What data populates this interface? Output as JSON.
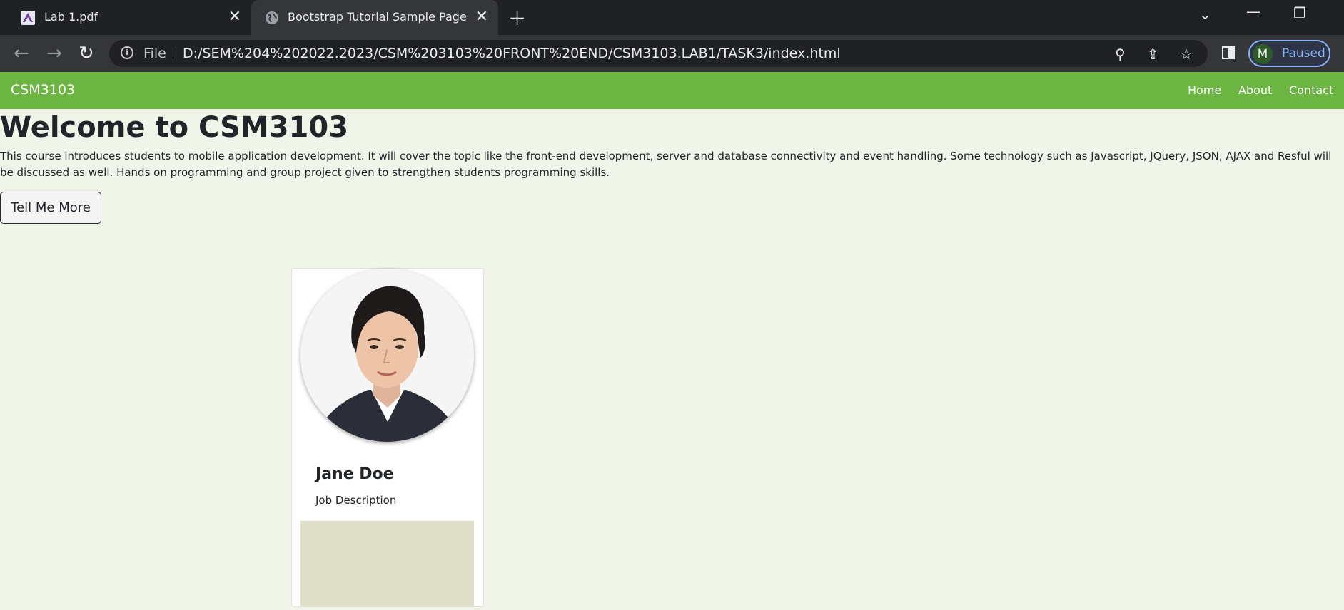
{
  "browser": {
    "tabs": [
      {
        "title": "Lab 1.pdf",
        "active": false,
        "icon": "pdf-icon"
      },
      {
        "title": "Bootstrap Tutorial Sample Page",
        "active": true,
        "icon": "globe-icon"
      }
    ],
    "address": {
      "scheme_label": "File",
      "url": "D:/SEM%204%202022.2023/CSM%203103%20FRONT%20END/CSM3103.LAB1/TASK3/index.html"
    },
    "profile": {
      "initial": "M",
      "status": "Paused"
    }
  },
  "page": {
    "navbar": {
      "brand": "CSM3103",
      "links": [
        "Home",
        "About",
        "Contact"
      ],
      "color": "#6cb543"
    },
    "hero": {
      "title": "Welcome to CSM3103",
      "text": "This course introduces students to mobile application development. It will cover the topic like the front-end development, server and database connectivity and event handling. Some technology such as Javascript, JQuery, JSON, AJAX and Resful will be discussed as well. Hands on programming and group project given to strengthen students programming skills.",
      "button_label": "Tell Me More"
    },
    "card": {
      "name": "Jane Doe",
      "description": "Job Description"
    },
    "background_color": "#f1f5e9"
  }
}
